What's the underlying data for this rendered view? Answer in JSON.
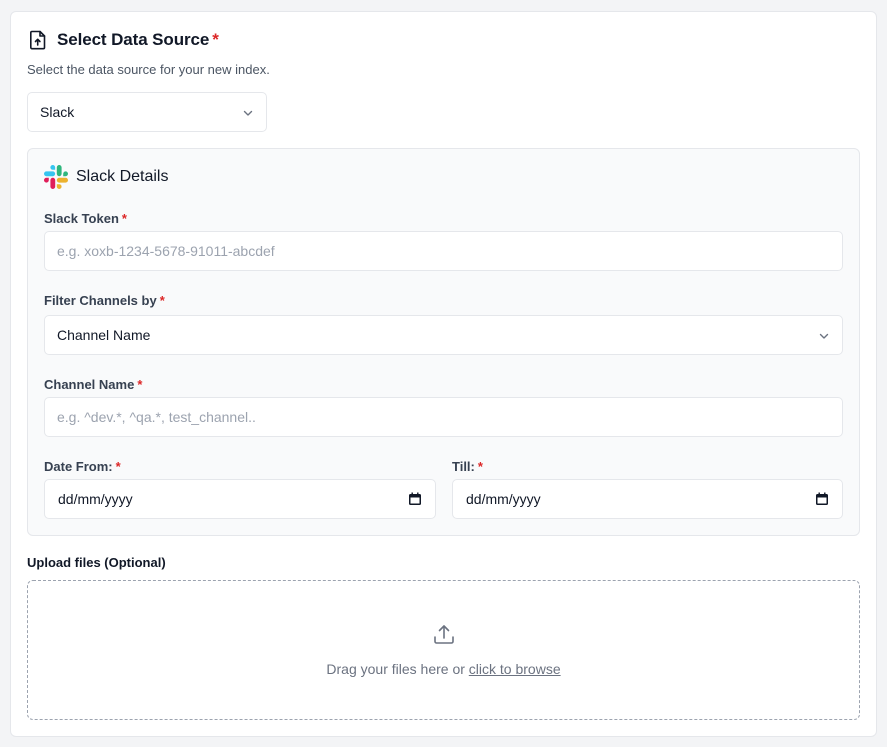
{
  "header": {
    "icon": "file-upload-icon",
    "title": "Select Data Source",
    "required_mark": "*",
    "subtitle": "Select the data source for your new index."
  },
  "source_select": {
    "value": "Slack",
    "icon": "chevron-down-icon"
  },
  "slack_details": {
    "icon": "slack-logo-icon",
    "title": "Slack Details",
    "token": {
      "label": "Slack Token",
      "required_mark": "*",
      "value": "",
      "placeholder": "e.g. xoxb-1234-5678-91011-abcdef"
    },
    "filter": {
      "label": "Filter Channels by",
      "required_mark": "*",
      "value": "Channel Name",
      "icon": "chevron-down-icon"
    },
    "channel_name": {
      "label": "Channel Name",
      "required_mark": "*",
      "value": "",
      "placeholder": "e.g. ^dev.*, ^qa.*, test_channel.."
    },
    "date_from": {
      "label": "Date From:",
      "required_mark": "*",
      "value": "dd/mm/yyyy",
      "icon": "calendar-icon"
    },
    "date_till": {
      "label": "Till:",
      "required_mark": "*",
      "value": "dd/mm/yyyy",
      "icon": "calendar-icon"
    }
  },
  "upload": {
    "label": "Upload files (Optional)",
    "icon": "upload-icon",
    "text": "Drag your files here or ",
    "link": "click to browse"
  },
  "colors": {
    "required": "#dc2626",
    "border": "#e5e7eb",
    "panel_bg": "#f9fafb",
    "muted_text": "#6b7280"
  }
}
